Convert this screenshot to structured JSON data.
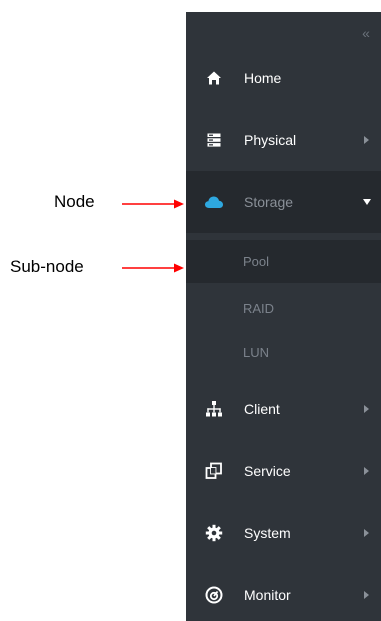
{
  "sidebar": {
    "collapse_icon": "double-chevron-left-icon",
    "items": [
      {
        "label": "Home",
        "icon": "home-icon",
        "has_submenu": false
      },
      {
        "label": "Physical",
        "icon": "server-icon",
        "has_submenu": true
      },
      {
        "label": "Storage",
        "icon": "cloud-icon",
        "has_submenu": true,
        "expanded": true,
        "children": [
          {
            "label": "Pool",
            "selected": true
          },
          {
            "label": "RAID"
          },
          {
            "label": "LUN"
          }
        ]
      },
      {
        "label": "Client",
        "icon": "network-icon",
        "has_submenu": true
      },
      {
        "label": "Service",
        "icon": "service-icon",
        "has_submenu": true
      },
      {
        "label": "System",
        "icon": "gear-icon",
        "has_submenu": true
      },
      {
        "label": "Monitor",
        "icon": "gauge-icon",
        "has_submenu": true
      }
    ]
  },
  "annotations": {
    "node_label": "Node",
    "subnode_label": "Sub-node",
    "arrow_color": "#ff0000"
  },
  "colors": {
    "sidebar_bg": "#2f343a",
    "active_bg": "#25292e",
    "accent": "#2ea8e0"
  }
}
